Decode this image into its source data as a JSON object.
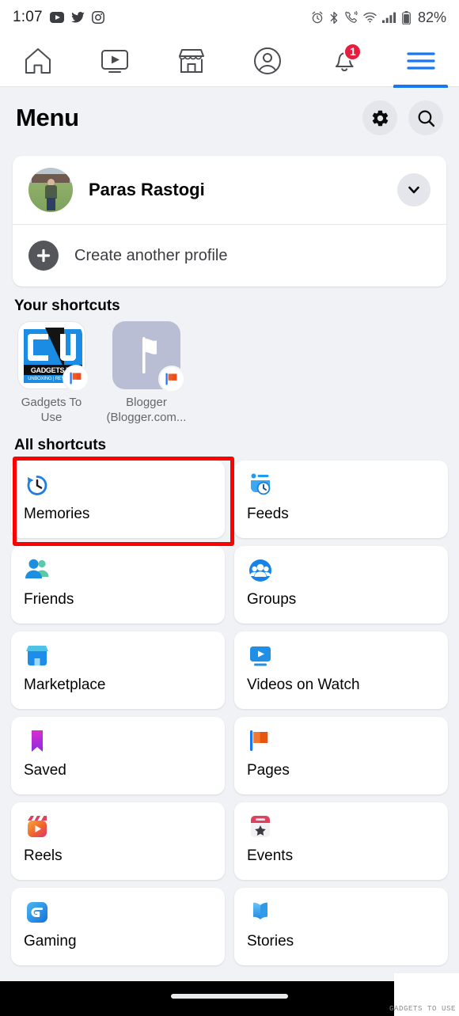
{
  "status_bar": {
    "time": "1:07",
    "left_icons": [
      "youtube-icon",
      "twitter-icon",
      "instagram-icon"
    ],
    "right_icons": [
      "alarm-icon",
      "bluetooth-icon",
      "vibrate-call-icon",
      "wifi-icon",
      "signal-icon",
      "battery-icon"
    ],
    "battery_percent": "82%"
  },
  "top_nav": {
    "tabs": [
      {
        "name": "home-tab",
        "icon": "home-icon",
        "active": false
      },
      {
        "name": "video-tab",
        "icon": "video-icon",
        "active": false
      },
      {
        "name": "marketplace-tab",
        "icon": "storefront-icon",
        "active": false
      },
      {
        "name": "profile-tab",
        "icon": "person-circle-icon",
        "active": false
      },
      {
        "name": "notifications-tab",
        "icon": "bell-icon",
        "active": false,
        "badge": "1"
      },
      {
        "name": "menu-tab",
        "icon": "hamburger-icon",
        "active": true
      }
    ],
    "accent_color": "#1877f2",
    "badge_color": "#e41e3f"
  },
  "header": {
    "title": "Menu",
    "settings_label": "gear-icon",
    "search_label": "search-icon"
  },
  "profile": {
    "name": "Paras Rastogi",
    "expand_icon": "chevron-down-icon",
    "create_profile_label": "Create another profile",
    "create_profile_icon": "plus-icon"
  },
  "your_shortcuts": {
    "title": "Your shortcuts",
    "items": [
      {
        "label": "Gadgets To Use",
        "icon": "gadgets-to-use-logo",
        "badge_icon": "page-flag-icon",
        "logo_text_main": "GADGETS TO",
        "logo_text_sub": "UNBOXING | REVIEWS |"
      },
      {
        "label": "Blogger (Blogger.com...",
        "icon": "white-flag-icon",
        "badge_icon": "page-flag-icon"
      }
    ]
  },
  "all_shortcuts": {
    "title": "All shortcuts",
    "items": [
      {
        "label": "Memories",
        "icon": "clock-rewind-icon",
        "color": "#1f7fe0",
        "highlighted": true
      },
      {
        "label": "Feeds",
        "icon": "feeds-clock-icon",
        "color": "#1f9bf0",
        "highlighted": false
      },
      {
        "label": "Friends",
        "icon": "friends-icon",
        "color": "#1d8fe0",
        "highlighted": false
      },
      {
        "label": "Groups",
        "icon": "groups-icon",
        "color": "#1683e8",
        "highlighted": false
      },
      {
        "label": "Marketplace",
        "icon": "storefront-icon",
        "color": "#1c8de8",
        "highlighted": false
      },
      {
        "label": "Videos on Watch",
        "icon": "video-play-icon",
        "color": "#1f8fe8",
        "highlighted": false
      },
      {
        "label": "Saved",
        "icon": "bookmark-icon",
        "color": "#9a33d8",
        "highlighted": false
      },
      {
        "label": "Pages",
        "icon": "page-flag-icon",
        "color": "#f05a28",
        "highlighted": false
      },
      {
        "label": "Reels",
        "icon": "reels-icon",
        "color": "#f0622e",
        "highlighted": false
      },
      {
        "label": "Events",
        "icon": "calendar-star-icon",
        "color": "#e0405e",
        "highlighted": false
      },
      {
        "label": "Gaming",
        "icon": "gaming-icon",
        "color": "#1d8fe0",
        "highlighted": false
      },
      {
        "label": "Stories",
        "icon": "book-icon",
        "color": "#2f9ae8",
        "highlighted": false
      }
    ],
    "highlight_color": "#ff0000"
  },
  "watermark": "GADGETS TO USE"
}
